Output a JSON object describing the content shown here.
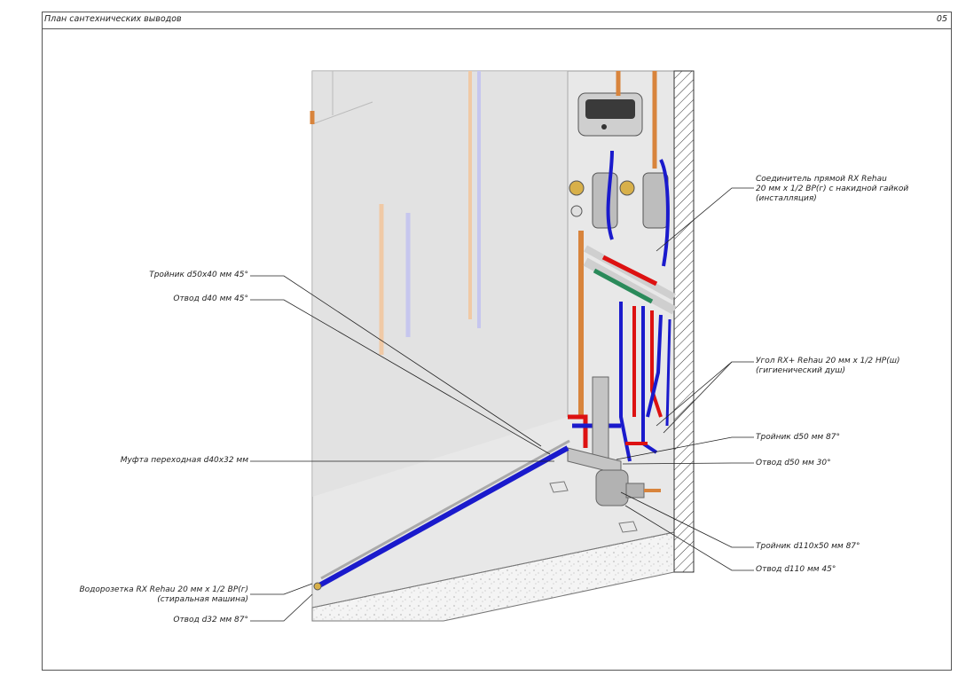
{
  "sheet": {
    "title": "План сантехнических выводов",
    "page_number": "05"
  },
  "labels": {
    "coupling_straight": [
      "Соединитель прямой RX Rehau",
      "20 мм х 1/2 ВР(г) с накидной гайкой",
      "(инсталляция)"
    ],
    "tee_d50x40": "Тройник d50x40 мм 45°",
    "bend_d40": "Отвод d40 мм 45°",
    "elbow_rx": [
      "Угол RX+ Rehau 20 мм х 1/2 НР(ш)",
      "(гигиенический душ)"
    ],
    "tee_d50": "Тройник d50 мм 87°",
    "bend_d50": "Отвод d50 мм 30°",
    "reducer_d40x32": "Муфта переходная d40x32 мм",
    "tee_d110x50": "Тройник d110x50 мм 87°",
    "bend_d110": "Отвод d110 мм 45°",
    "water_socket": [
      "Водорозетка RX Rehau 20 мм х 1/2 ВР(г)",
      "(стиральная машина)"
    ],
    "bend_d32": "Отвод d32 мм 87°"
  },
  "colors": {
    "cold_water": "#1a1acc",
    "hot_water": "#dd1111",
    "copper": "#d8843c",
    "drain_pipe": "#b8b8b8",
    "wall": "#e6e6e6"
  }
}
